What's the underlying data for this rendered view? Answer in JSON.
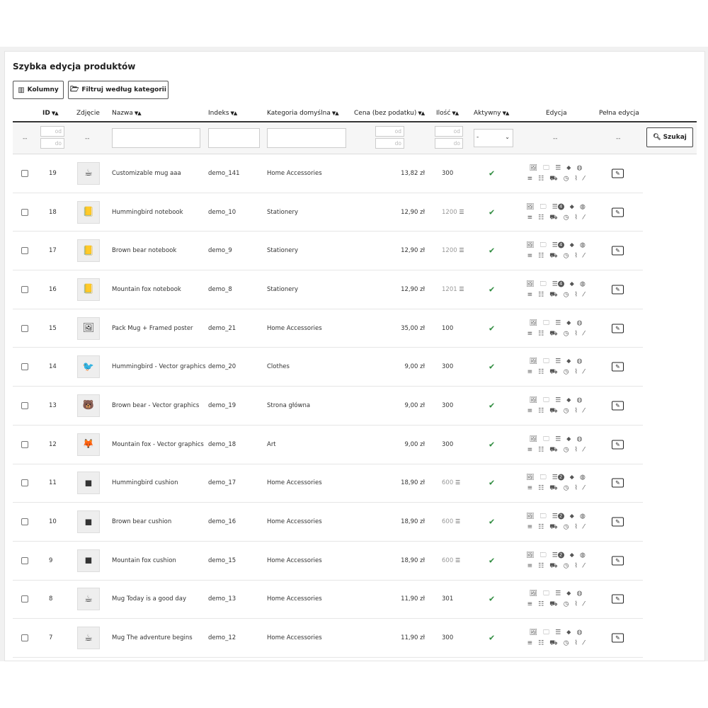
{
  "title": "Szybka edycja produktów",
  "buttons": {
    "columns": "Kolumny",
    "filter_category": "Filtruj według kategorii",
    "search": "Szukaj"
  },
  "columns": {
    "id": "ID",
    "image": "Zdjęcie",
    "name": "Nazwa",
    "reference": "Indeks",
    "category": "Kategoria domyślna",
    "price": "Cena (bez podatku)",
    "quantity": "Ilość",
    "active": "Aktywny",
    "edit": "Edycja",
    "full_edit": "Pełna edycja"
  },
  "filters": {
    "empty": "--",
    "from": "od",
    "to": "do",
    "active_selected": "-"
  },
  "icons": {
    "sort": "sort-icon",
    "columns": "columns-icon",
    "folder": "folder-icon",
    "search": "search-icon",
    "active": "check-icon",
    "edit": "pencil-icon",
    "combinations": "list-icon"
  },
  "colors": {
    "active_check": "#2e8b3e",
    "text": "#333333",
    "border": "#dddddd"
  },
  "rows": [
    {
      "id": "19",
      "name": "Customizable mug aaa",
      "reference": "demo_141",
      "category": "Home Accessories",
      "price": "13,82 zł",
      "quantity": "300",
      "qty_combo": false,
      "thumb": "☕",
      "icon_set": "a"
    },
    {
      "id": "18",
      "name": "Hummingbird notebook",
      "reference": "demo_10",
      "category": "Stationery",
      "price": "12,90 zł",
      "quantity": "1200",
      "qty_combo": true,
      "thumb": "📒",
      "icon_set": "b",
      "badge": "4"
    },
    {
      "id": "17",
      "name": "Brown bear notebook",
      "reference": "demo_9",
      "category": "Stationery",
      "price": "12,90 zł",
      "quantity": "1200",
      "qty_combo": true,
      "thumb": "📒",
      "icon_set": "b",
      "badge": "4"
    },
    {
      "id": "16",
      "name": "Mountain fox notebook",
      "reference": "demo_8",
      "category": "Stationery",
      "price": "12,90 zł",
      "quantity": "1201",
      "qty_combo": true,
      "thumb": "📒",
      "icon_set": "b",
      "badge": "4"
    },
    {
      "id": "15",
      "name": "Pack Mug + Framed poster",
      "reference": "demo_21",
      "category": "Home Accessories",
      "price": "35,00 zł",
      "quantity": "100",
      "qty_combo": false,
      "thumb": "🖼",
      "icon_set": "a"
    },
    {
      "id": "14",
      "name": "Hummingbird - Vector graphics",
      "reference": "demo_20",
      "category": "Clothes",
      "price": "9,00 zł",
      "quantity": "300",
      "qty_combo": false,
      "thumb": "🐦",
      "icon_set": "a"
    },
    {
      "id": "13",
      "name": "Brown bear - Vector graphics",
      "reference": "demo_19",
      "category": "Strona główna",
      "price": "9,00 zł",
      "quantity": "300",
      "qty_combo": false,
      "thumb": "🐻",
      "icon_set": "a"
    },
    {
      "id": "12",
      "name": "Mountain fox - Vector graphics",
      "reference": "demo_18",
      "category": "Art",
      "price": "9,00 zł",
      "quantity": "300",
      "qty_combo": false,
      "thumb": "🦊",
      "icon_set": "a"
    },
    {
      "id": "11",
      "name": "Hummingbird cushion",
      "reference": "demo_17",
      "category": "Home Accessories",
      "price": "18,90 zł",
      "quantity": "600",
      "qty_combo": true,
      "thumb": "◼",
      "icon_set": "b",
      "badge": "2"
    },
    {
      "id": "10",
      "name": "Brown bear cushion",
      "reference": "demo_16",
      "category": "Home Accessories",
      "price": "18,90 zł",
      "quantity": "600",
      "qty_combo": true,
      "thumb": "◼",
      "icon_set": "b",
      "badge": "2"
    },
    {
      "id": "9",
      "name": "Mountain fox cushion",
      "reference": "demo_15",
      "category": "Home Accessories",
      "price": "18,90 zł",
      "quantity": "600",
      "qty_combo": true,
      "thumb": "◼",
      "icon_set": "b",
      "badge": "2"
    },
    {
      "id": "8",
      "name": "Mug Today is a good day",
      "reference": "demo_13",
      "category": "Home Accessories",
      "price": "11,90 zł",
      "quantity": "301",
      "qty_combo": false,
      "thumb": "☕",
      "icon_set": "a"
    },
    {
      "id": "7",
      "name": "Mug The adventure begins",
      "reference": "demo_12",
      "category": "Home Accessories",
      "price": "11,90 zł",
      "quantity": "300",
      "qty_combo": false,
      "thumb": "☕",
      "icon_set": "a"
    }
  ]
}
